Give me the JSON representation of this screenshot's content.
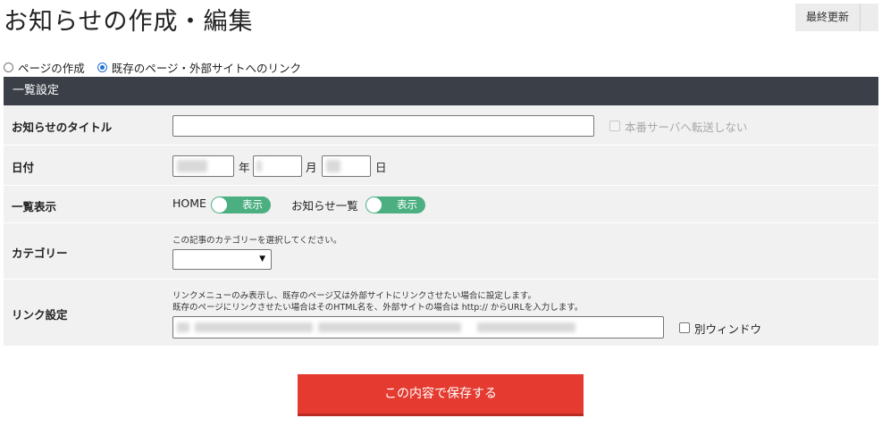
{
  "page": {
    "title": "お知らせの作成・編集"
  },
  "header": {
    "last_updated_label": "最終更新"
  },
  "mode": {
    "options": [
      {
        "label": "ページの作成",
        "checked": false
      },
      {
        "label": "既存のページ・外部サイトへのリンク",
        "checked": true
      }
    ]
  },
  "section": {
    "title": "一覧設定"
  },
  "rows": {
    "title": {
      "label": "お知らせのタイトル",
      "value": "",
      "no_transfer_label": "本番サーバへ転送しない"
    },
    "date": {
      "label": "日付",
      "year_suffix": "年",
      "month_suffix": "月",
      "day_suffix": "日"
    },
    "display": {
      "label": "一覧表示",
      "home_label": "HOME",
      "home_toggle": "表示",
      "news_list_label": "お知らせ一覧",
      "news_toggle": "表示"
    },
    "category": {
      "label": "カテゴリー",
      "note": "この記事のカテゴリーを選択してください。",
      "selected": ""
    },
    "link": {
      "label": "リンク設定",
      "note_1": "リンクメニューのみ表示し、既存のページ又は外部サイトにリンクさせたい場合に設定します。",
      "note_2": "既存のページにリンクさせたい場合はそのHTML名を、外部サイトの場合は http:// からURLを入力します。",
      "new_window_label": "別ウィンドウ"
    }
  },
  "actions": {
    "save_label": "この内容で保存する"
  },
  "colors": {
    "header_bar": "#3b3f48",
    "row_bg": "#f1f1f1",
    "toggle_on": "#4caf82",
    "save_button": "#e53a2f",
    "radio_checked": "#1f6fd1"
  }
}
